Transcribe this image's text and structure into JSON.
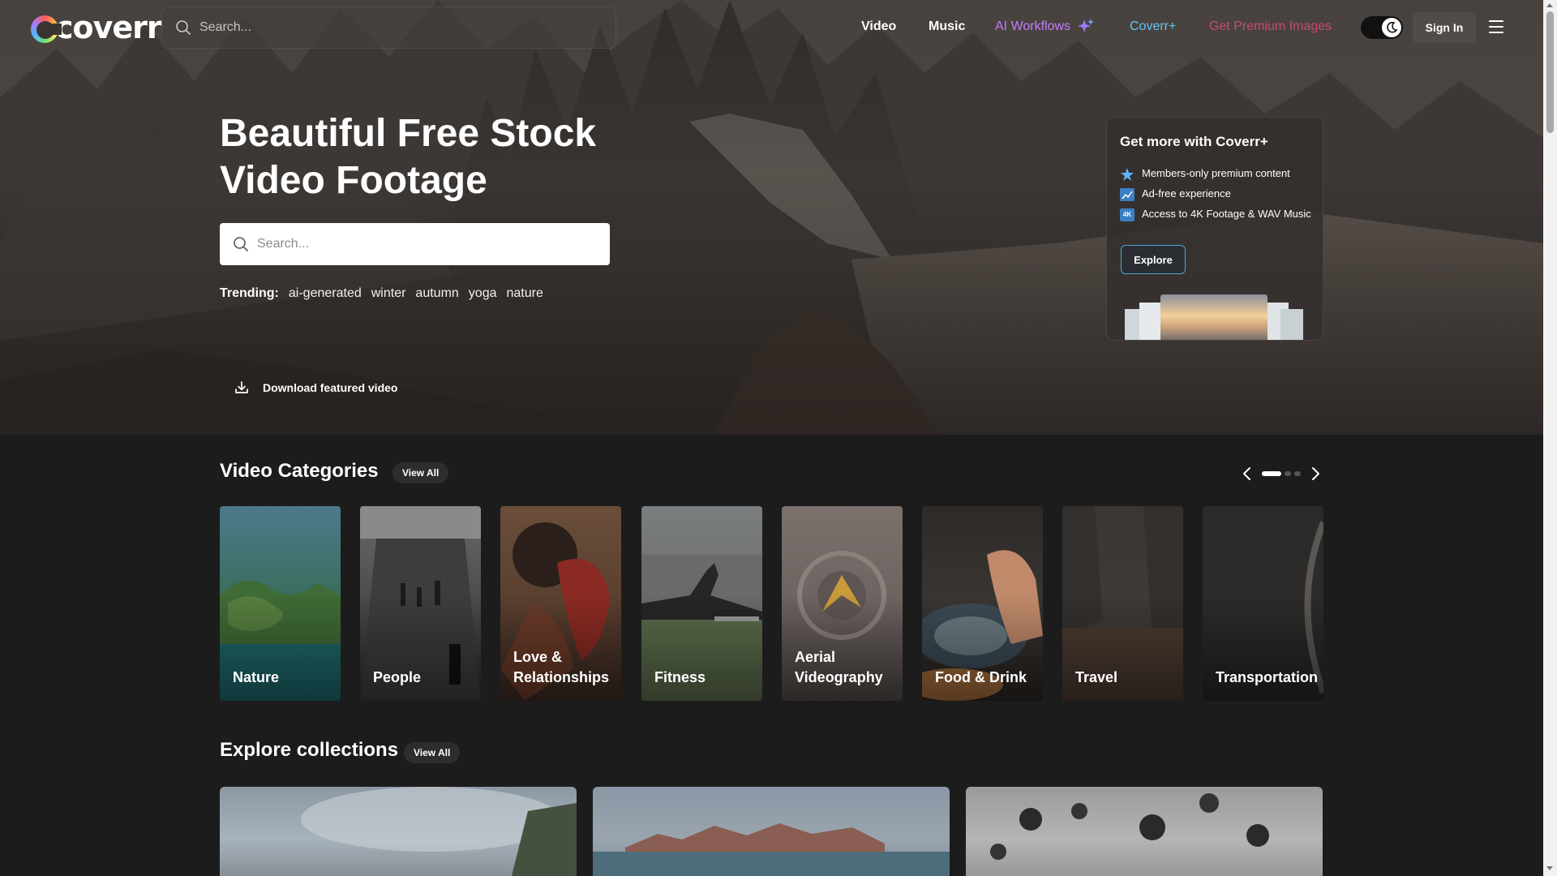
{
  "brand": {
    "logo_text": "coverr"
  },
  "header": {
    "search_placeholder": "Search...",
    "nav": {
      "video": "Video",
      "music": "Music",
      "ai_workflows": "AI Workflows",
      "coverr_plus": "Coverr+",
      "premium_images": "Get Premium Images"
    },
    "theme_toggle": "dark",
    "sign_in": "Sign In"
  },
  "hero": {
    "title_line1": "Beautiful Free Stock",
    "title_line2": "Video Footage",
    "search_placeholder": "Search...",
    "trending_label": "Trending:",
    "trending": [
      "ai-generated",
      "winter",
      "autumn",
      "yoga",
      "nature"
    ],
    "download_label": "Download featured video"
  },
  "promo": {
    "title": "Get more with Coverr+",
    "items": [
      {
        "icon": "star-badge-icon",
        "text": "Members-only premium content"
      },
      {
        "icon": "ad-free-icon",
        "text": "Ad-free experience"
      },
      {
        "icon": "4k-icon",
        "badge": "4K",
        "text": "Access to 4K Footage & WAV Music"
      }
    ],
    "explore": "Explore"
  },
  "categories": {
    "title": "Video Categories",
    "view_all": "View All",
    "pages": 3,
    "active_page": 1,
    "items": [
      {
        "label": "Nature"
      },
      {
        "label": "People"
      },
      {
        "label": "Love & Relationships"
      },
      {
        "label": "Fitness"
      },
      {
        "label": "Aerial Videography"
      },
      {
        "label": "Food & Drink"
      },
      {
        "label": "Travel"
      },
      {
        "label": "Transportation"
      }
    ]
  },
  "collections": {
    "title": "Explore collections",
    "view_all": "View All"
  },
  "colors": {
    "accent_ai": "#c57bff",
    "accent_coverr_plus": "#62c6f2",
    "accent_premium": "#ff4f86",
    "page_bg": "#1c1c1c"
  }
}
